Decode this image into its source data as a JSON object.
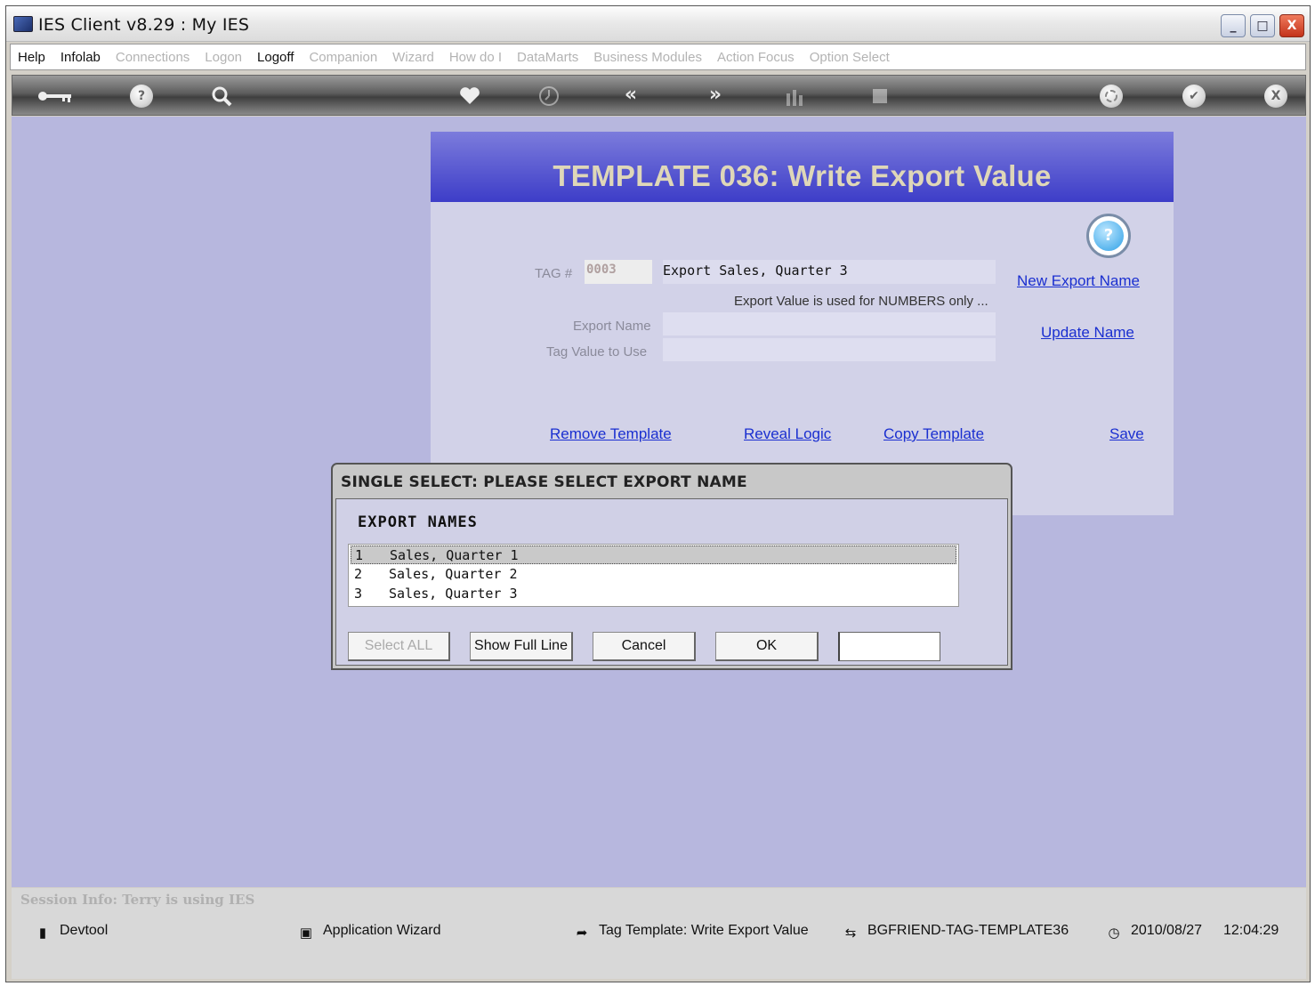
{
  "window": {
    "title": "IES Client v8.29 : My IES",
    "minimize": "_",
    "maximize": "□",
    "close": "X"
  },
  "menu": [
    {
      "label": "Help",
      "enabled": true
    },
    {
      "label": "Infolab",
      "enabled": true
    },
    {
      "label": "Connections",
      "enabled": false
    },
    {
      "label": "Logon",
      "enabled": false
    },
    {
      "label": "Logoff",
      "enabled": true
    },
    {
      "label": "Companion",
      "enabled": false
    },
    {
      "label": "Wizard",
      "enabled": false
    },
    {
      "label": "How do I",
      "enabled": false
    },
    {
      "label": "DataMarts",
      "enabled": false
    },
    {
      "label": "Business Modules",
      "enabled": false
    },
    {
      "label": "Action Focus",
      "enabled": false
    },
    {
      "label": "Option Select",
      "enabled": false
    }
  ],
  "toolbar": {
    "icons": [
      "key-icon",
      "help-icon",
      "search-icon",
      "heart-icon",
      "clock-icon",
      "back-icon",
      "forward-icon",
      "bars-icon",
      "stop-icon",
      "recycle-icon",
      "check-icon",
      "close-icon"
    ],
    "help_glyph": "?",
    "back_glyph": "«",
    "forward_glyph": "»",
    "check_glyph": "✔",
    "close_glyph": "X"
  },
  "template": {
    "title": "TEMPLATE 036: Write Export Value",
    "help_glyph": "?",
    "tag_label": "TAG #",
    "tag_value": "0003",
    "export_display": "Export Sales, Quarter 3",
    "note": "Export Value is used for NUMBERS only ...",
    "export_name_label": "Export Name",
    "tag_value_label": "Tag Value to Use",
    "links": {
      "new_export_name": "New Export Name",
      "update_name": "Update  Name",
      "remove_template": "Remove Template",
      "reveal_logic": "Reveal Logic",
      "copy_template": "Copy Template",
      "save": "Save"
    }
  },
  "dialog": {
    "title": "SINGLE SELECT: PLEASE SELECT EXPORT NAME",
    "list_header": "EXPORT  NAMES",
    "items": [
      {
        "num": "1",
        "text": "Sales, Quarter 1",
        "selected": true
      },
      {
        "num": "2",
        "text": "Sales, Quarter 2",
        "selected": false
      },
      {
        "num": "3",
        "text": "Sales, Quarter 3",
        "selected": false
      }
    ],
    "buttons": {
      "select_all": "Select ALL",
      "show_full_line": "Show Full Line",
      "cancel": "Cancel",
      "ok": "OK"
    },
    "input_value": ""
  },
  "session": "Session Info: Terry is using IES",
  "status": {
    "devtool": "Devtool",
    "app_wizard": "Application Wizard",
    "tag_template": "Tag Template: Write Export Value",
    "server": "BGFRIEND-TAG-TEMPLATE36",
    "date": "2010/08/27",
    "time": "12:04:29"
  }
}
